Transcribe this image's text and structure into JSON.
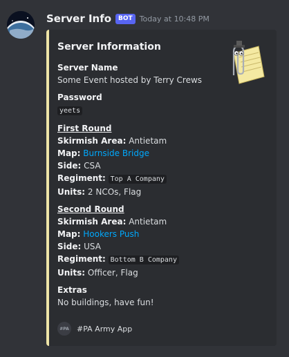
{
  "message": {
    "username": "Server Info",
    "bot_tag": "BOT",
    "timestamp": "Today at 10:48 PM"
  },
  "embed": {
    "accent_color": "#eee4a7",
    "title": "Server Information",
    "thumbnail_icon": "clippy-paperclip-icon",
    "server_name_label": "Server Name",
    "server_name_value": "Some Event hosted by Terry Crews",
    "password_label": "Password",
    "password_value": "yeets",
    "rounds": [
      {
        "heading": "First Round",
        "skirmish_label": "Skirmish Area:",
        "skirmish_value": "Antietam",
        "map_label": "Map:",
        "map_value": "Burnside Bridge",
        "side_label": "Side:",
        "side_value": "CSA",
        "regiment_label": "Regiment:",
        "regiment_value": "Top A Company",
        "units_label": "Units:",
        "units_value": "2 NCOs, Flag"
      },
      {
        "heading": "Second Round",
        "skirmish_label": "Skirmish Area:",
        "skirmish_value": "Antietam",
        "map_label": "Map:",
        "map_value": "Hookers Push",
        "side_label": "Side:",
        "side_value": "USA",
        "regiment_label": "Regiment:",
        "regiment_value": "Bottom B Company",
        "units_label": "Units:",
        "units_value": "Officer, Flag"
      }
    ],
    "extras_label": "Extras",
    "extras_value": "No buildings, have fun!",
    "footer_icon_text": "#PA",
    "footer_text": "#PA Army App"
  }
}
